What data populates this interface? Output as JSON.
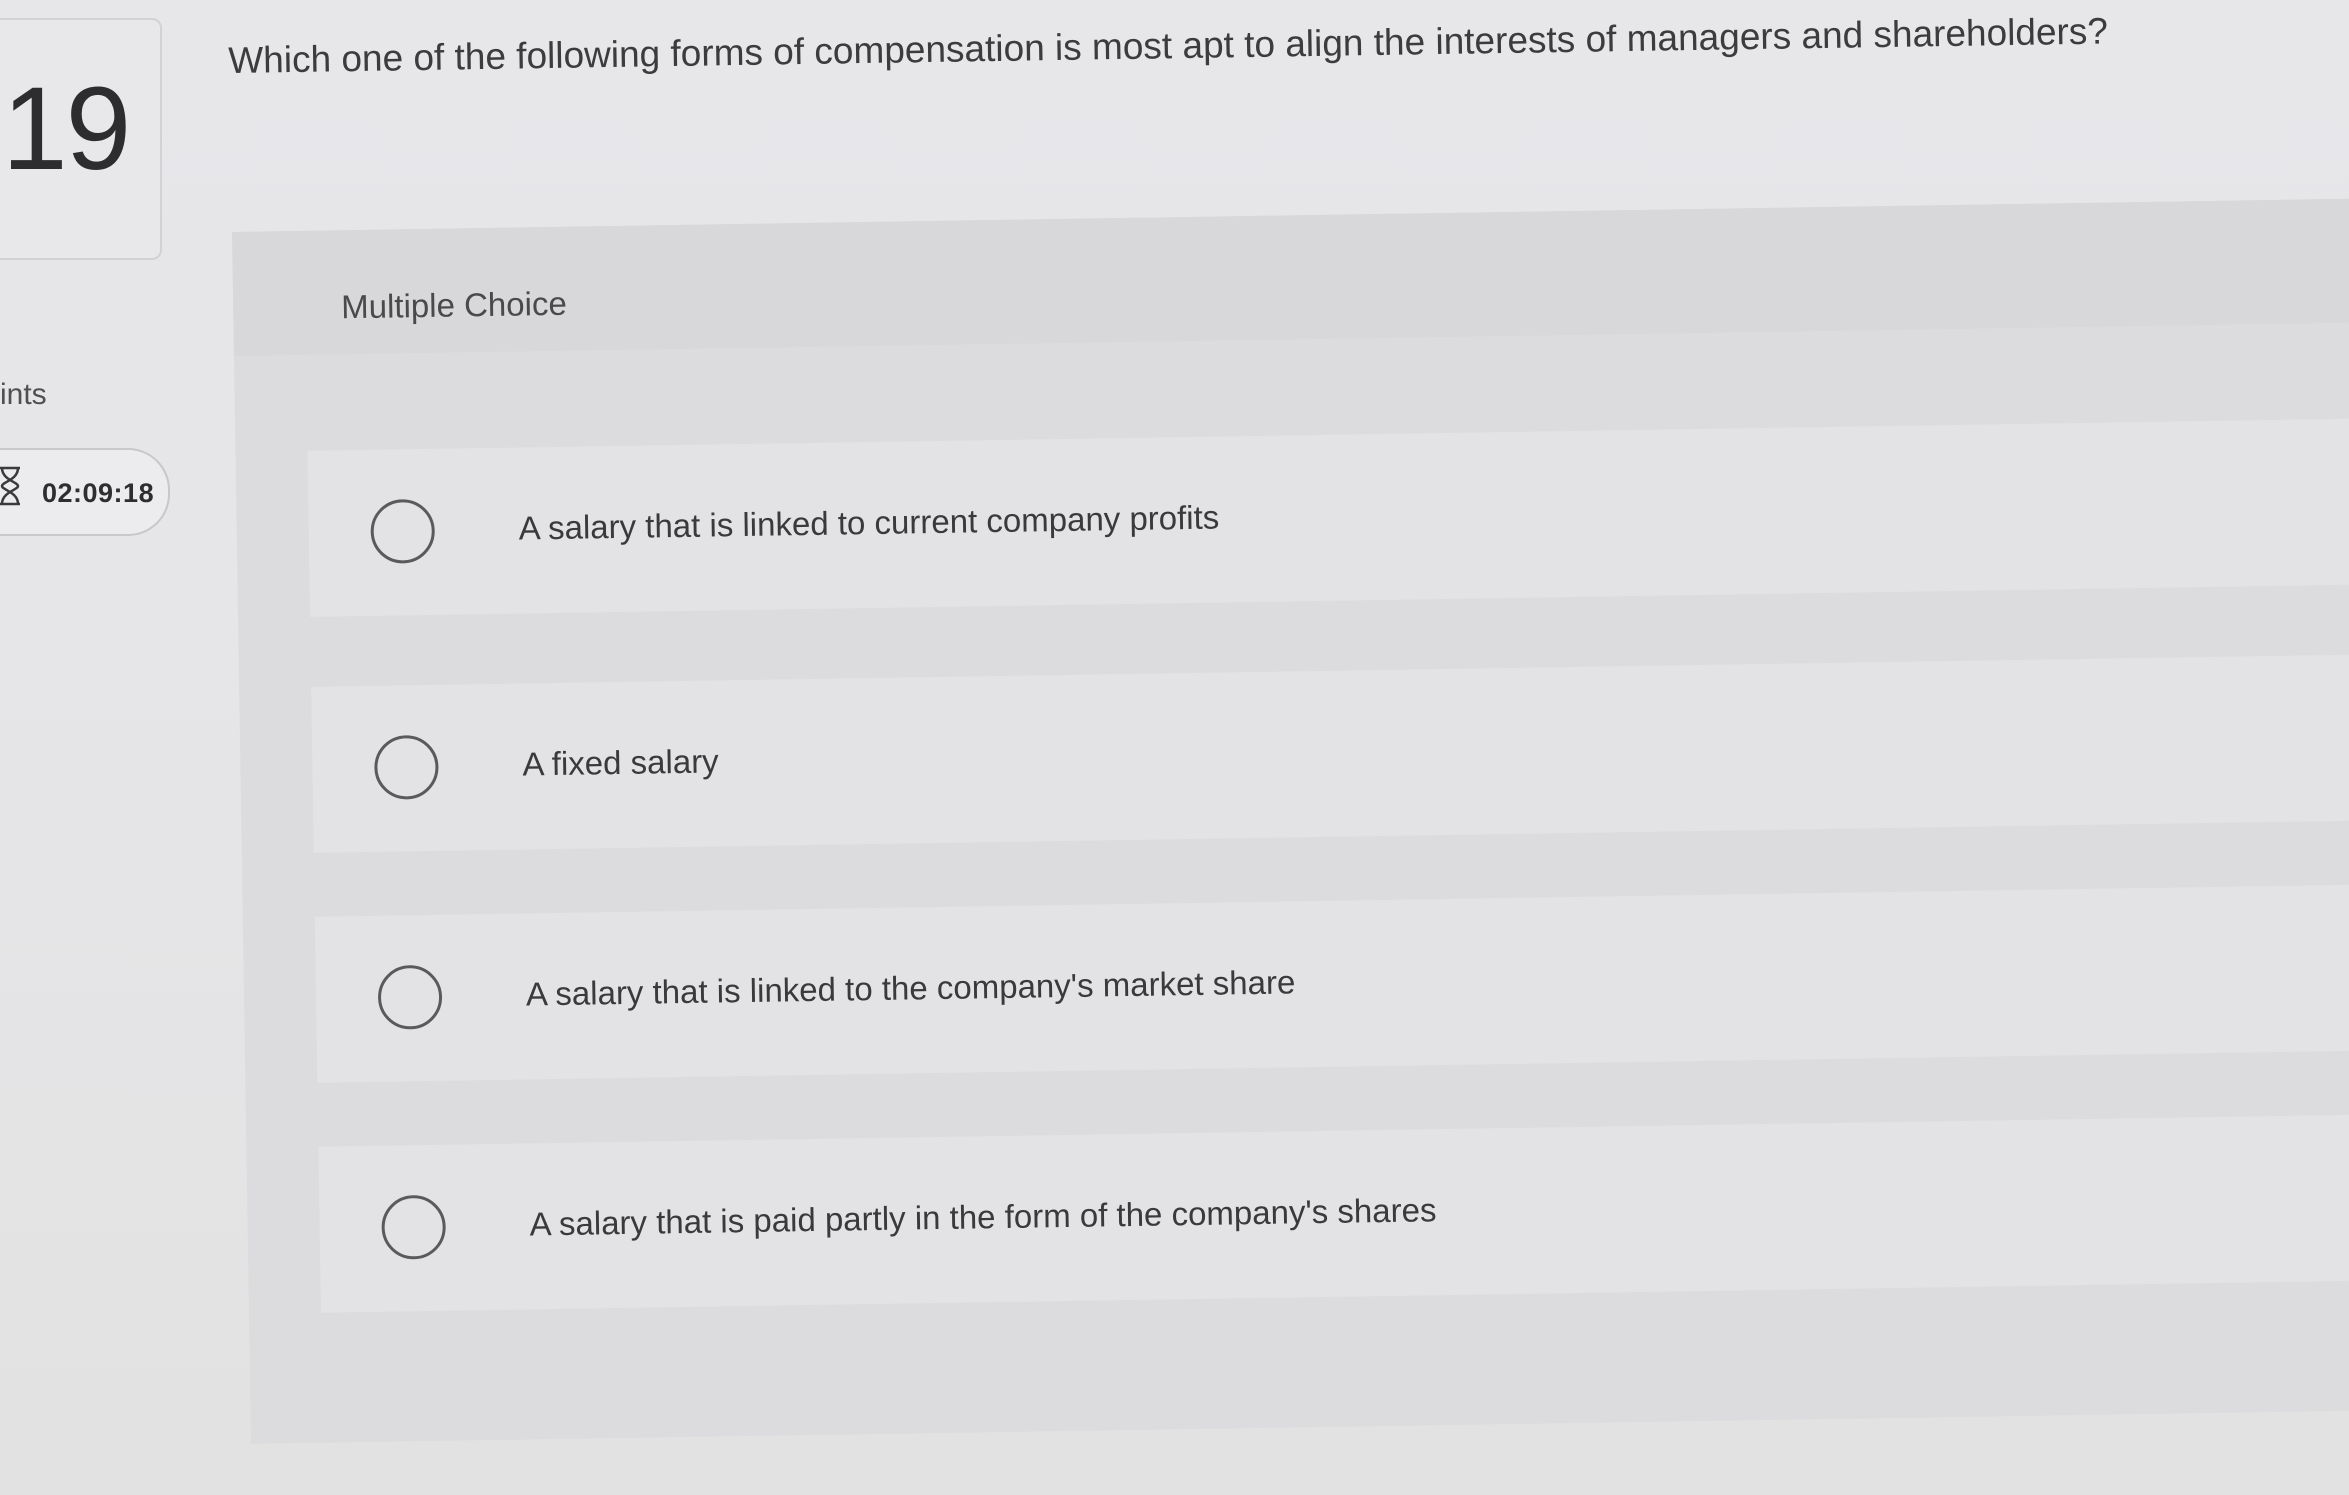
{
  "question": {
    "number": "19",
    "text": "Which one of the following forms of compensation is most apt to align the interests of managers and shareholders?",
    "type_label": "Multiple Choice"
  },
  "sidebar": {
    "points_label": "ints",
    "timer": "02:09:18",
    "timer_icon": "hourglass-icon"
  },
  "options": [
    {
      "label": "A salary that is linked to current company profits"
    },
    {
      "label": "A fixed salary"
    },
    {
      "label": "A salary that is linked to the company's market share"
    },
    {
      "label": "A salary that is paid partly in the form of the company's shares"
    }
  ]
}
